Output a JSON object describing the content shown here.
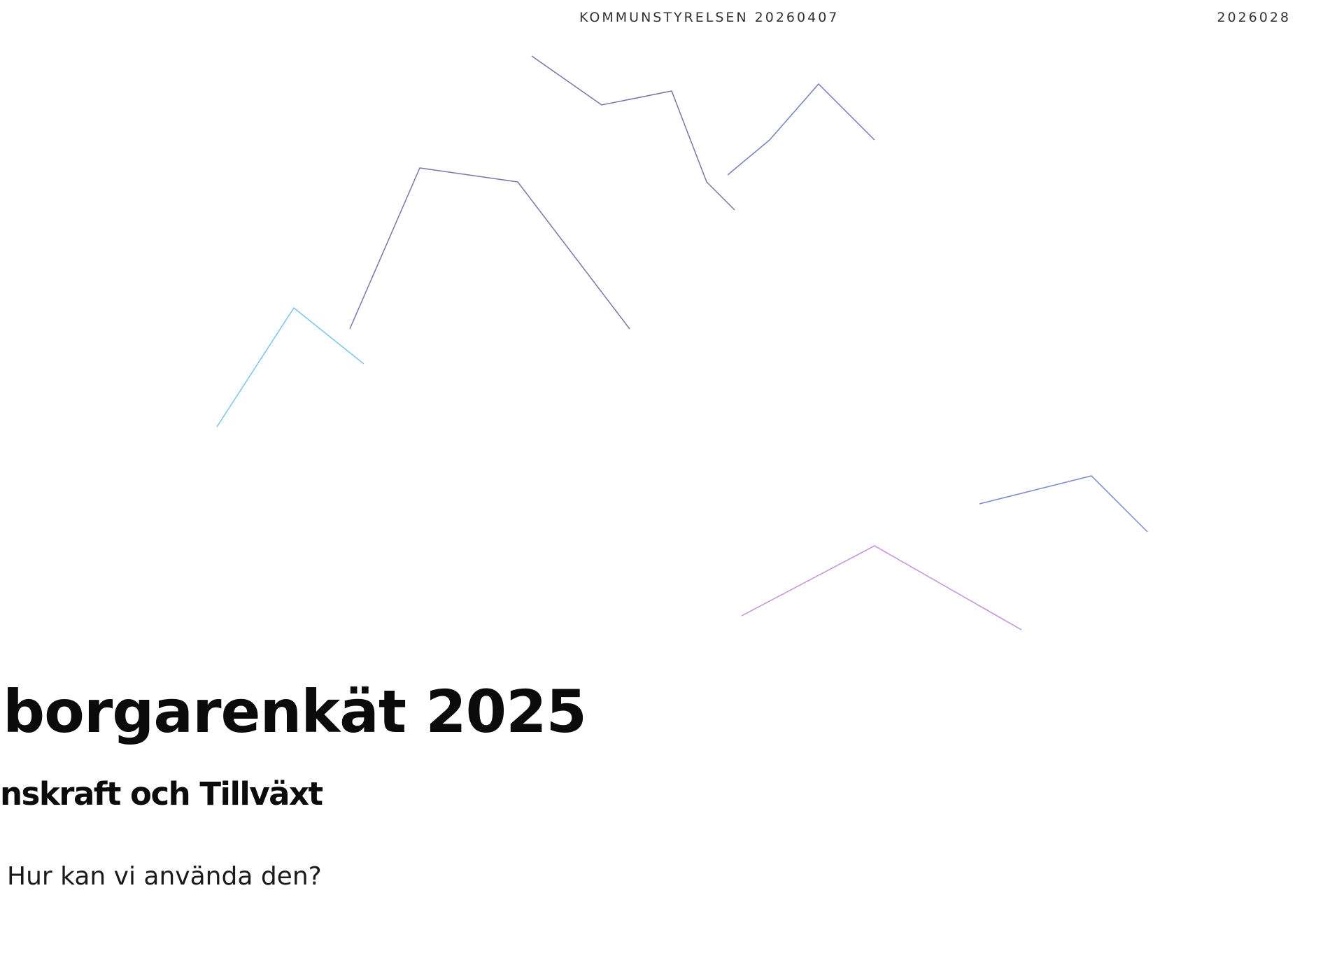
{
  "header": {
    "meeting_label": "KOMMUNSTYRELSEN 20260407",
    "doc_number": "2026028"
  },
  "cover": {
    "title": "borgarenkät 2025",
    "subtitle": "nskraft och Tillväxt",
    "question": "Hur kan vi använda den?"
  },
  "colors": {
    "cyan": "#10c8e8",
    "blue": "#2a4fd0",
    "navy": "#1a1f6e",
    "violet": "#7a3fd0",
    "magenta": "#e040a0",
    "text": "#0b0b0b"
  }
}
